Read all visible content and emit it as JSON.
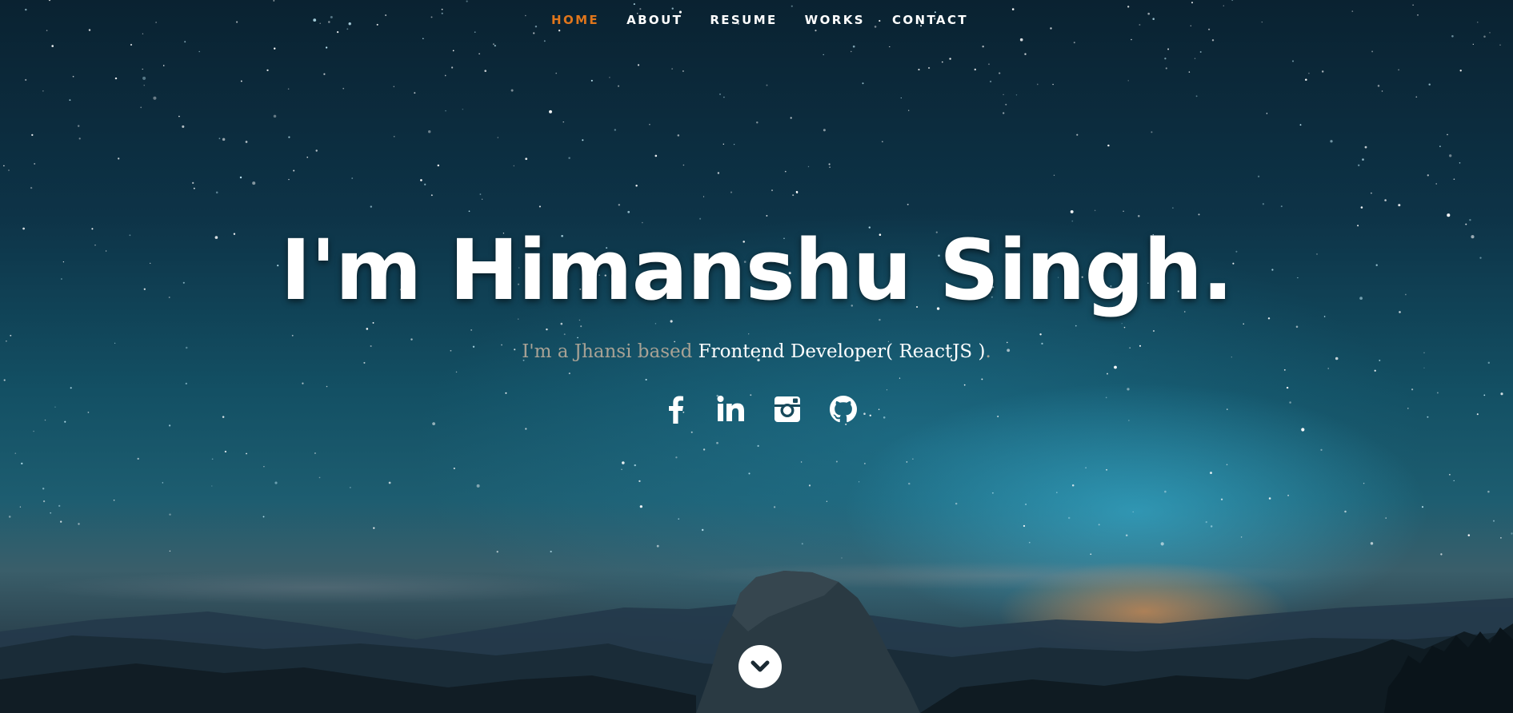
{
  "nav": {
    "items": [
      {
        "label": "HOME"
      },
      {
        "label": "ABOUT"
      },
      {
        "label": "RESUME"
      },
      {
        "label": "WORKS"
      },
      {
        "label": "CONTACT"
      }
    ],
    "active_index": 0,
    "active_color": "#e0761c"
  },
  "banner": {
    "title": "I'm Himanshu Singh.",
    "tagline_prefix": "I'm a Jhansi based ",
    "tagline_highlight": "Frontend Developer( ReactJS )",
    "tagline_suffix": "."
  },
  "social": [
    {
      "icon": "facebook-icon"
    },
    {
      "icon": "linkedin-icon"
    },
    {
      "icon": "instagram-icon"
    },
    {
      "icon": "github-icon"
    }
  ],
  "scroll_down": {
    "icon": "chevron-down-icon"
  }
}
